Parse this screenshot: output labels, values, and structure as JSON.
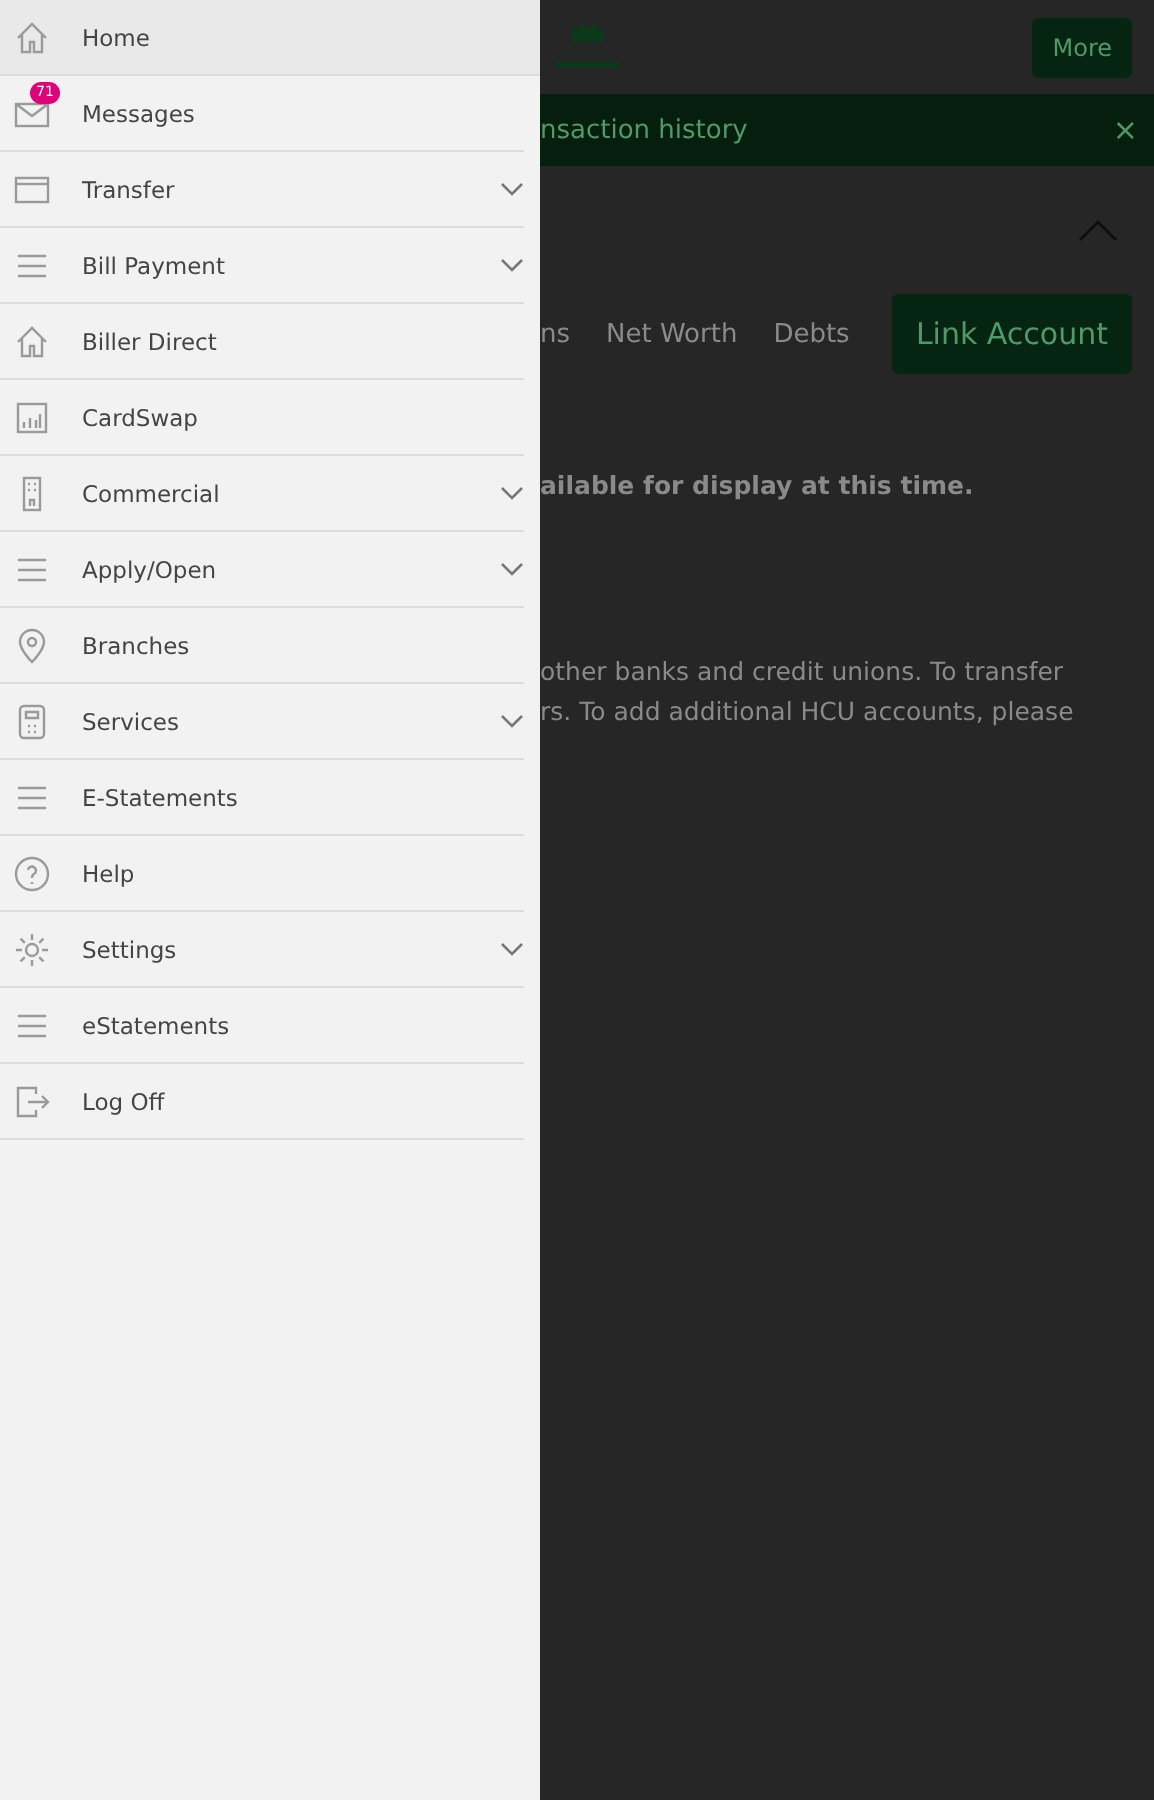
{
  "drawer": {
    "items": [
      {
        "label": "Home",
        "selected": true,
        "expandable": false
      },
      {
        "label": "Messages",
        "selected": false,
        "expandable": false,
        "badge": "71"
      },
      {
        "label": "Transfer",
        "selected": false,
        "expandable": true
      },
      {
        "label": "Bill Payment",
        "selected": false,
        "expandable": true
      },
      {
        "label": "Biller Direct",
        "selected": false,
        "expandable": false
      },
      {
        "label": "CardSwap",
        "selected": false,
        "expandable": false
      },
      {
        "label": "Commercial",
        "selected": false,
        "expandable": true
      },
      {
        "label": "Apply/Open",
        "selected": false,
        "expandable": true
      },
      {
        "label": "Branches",
        "selected": false,
        "expandable": false
      },
      {
        "label": "Services",
        "selected": false,
        "expandable": true
      },
      {
        "label": "E-Statements",
        "selected": false,
        "expandable": false
      },
      {
        "label": "Help",
        "selected": false,
        "expandable": false
      },
      {
        "label": "Settings",
        "selected": false,
        "expandable": true
      },
      {
        "label": "eStatements",
        "selected": false,
        "expandable": false
      },
      {
        "label": "Log Off",
        "selected": false,
        "expandable": false
      }
    ]
  },
  "page": {
    "more_button": "More",
    "banner": {
      "text": "nsaction history",
      "close": "×"
    },
    "tabs": [
      {
        "label": "ns",
        "selected": false
      },
      {
        "label": "Net Worth",
        "selected": false
      },
      {
        "label": "Debts",
        "selected": false
      }
    ],
    "link_button": "Link Account",
    "notice": "ailable for display at this time.",
    "paragraph_lines": [
      "other banks and credit unions. To transfer",
      "rs. To add additional HCU accounts, please"
    ]
  }
}
